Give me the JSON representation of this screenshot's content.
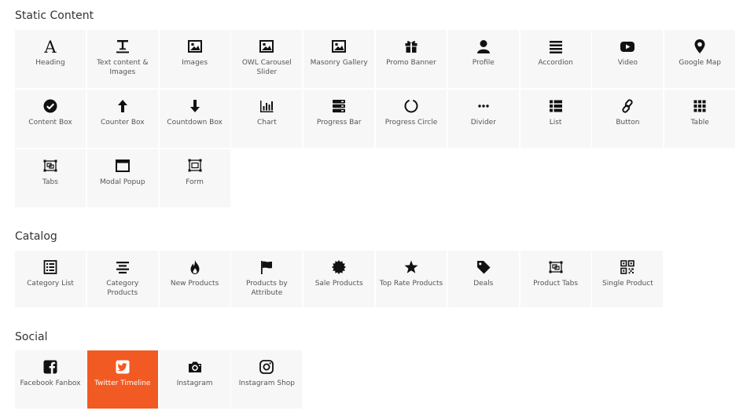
{
  "sections": {
    "static": {
      "title": "Static Content",
      "items": [
        {
          "label": "Heading",
          "icon": "heading-icon"
        },
        {
          "label": "Text content & Images",
          "icon": "text-content-icon"
        },
        {
          "label": "Images",
          "icon": "image-icon"
        },
        {
          "label": "OWL Carousel Slider",
          "icon": "image-icon"
        },
        {
          "label": "Masonry Gallery",
          "icon": "image-icon"
        },
        {
          "label": "Promo Banner",
          "icon": "gift-icon"
        },
        {
          "label": "Profile",
          "icon": "user-icon"
        },
        {
          "label": "Accordion",
          "icon": "bars-icon"
        },
        {
          "label": "Video",
          "icon": "youtube-icon"
        },
        {
          "label": "Google Map",
          "icon": "map-marker-icon"
        },
        {
          "label": "Content Box",
          "icon": "check-circle-icon"
        },
        {
          "label": "Counter Box",
          "icon": "arrow-up-icon"
        },
        {
          "label": "Countdown Box",
          "icon": "arrow-down-icon"
        },
        {
          "label": "Chart",
          "icon": "bar-chart-icon"
        },
        {
          "label": "Progress Bar",
          "icon": "server-icon"
        },
        {
          "label": "Progress Circle",
          "icon": "circle-notch-icon"
        },
        {
          "label": "Divider",
          "icon": "ellipsis-icon"
        },
        {
          "label": "List",
          "icon": "list-icon"
        },
        {
          "label": "Button",
          "icon": "link-icon"
        },
        {
          "label": "Table",
          "icon": "table-grid-icon"
        },
        {
          "label": "Tabs",
          "icon": "object-group-icon"
        },
        {
          "label": "Modal Popup",
          "icon": "window-icon"
        },
        {
          "label": "Form",
          "icon": "object-ungroup-icon"
        }
      ]
    },
    "catalog": {
      "title": "Catalog",
      "items": [
        {
          "label": "Category List",
          "icon": "list-alt-icon"
        },
        {
          "label": "Category Products",
          "icon": "align-center-icon"
        },
        {
          "label": "New Products",
          "icon": "fire-icon"
        },
        {
          "label": "Products by Attribute",
          "icon": "flag-icon"
        },
        {
          "label": "Sale Products",
          "icon": "certificate-icon"
        },
        {
          "label": "Top Rate Products",
          "icon": "star-icon"
        },
        {
          "label": "Deals",
          "icon": "tag-icon"
        },
        {
          "label": "Product Tabs",
          "icon": "object-group-icon"
        },
        {
          "label": "Single Product",
          "icon": "qrcode-icon"
        }
      ]
    },
    "social": {
      "title": "Social",
      "items": [
        {
          "label": "Facebook Fanbox",
          "icon": "facebook-icon"
        },
        {
          "label": "Twitter Timeline",
          "icon": "twitter-icon",
          "active": true
        },
        {
          "label": "Instagram",
          "icon": "camera-icon"
        },
        {
          "label": "Instagram Shop",
          "icon": "instagram-icon"
        }
      ]
    }
  },
  "colors": {
    "accent": "#f15a22",
    "tile_bg": "#f7f7f7",
    "text": "#333333",
    "label": "#555555",
    "icon": "#111111"
  }
}
